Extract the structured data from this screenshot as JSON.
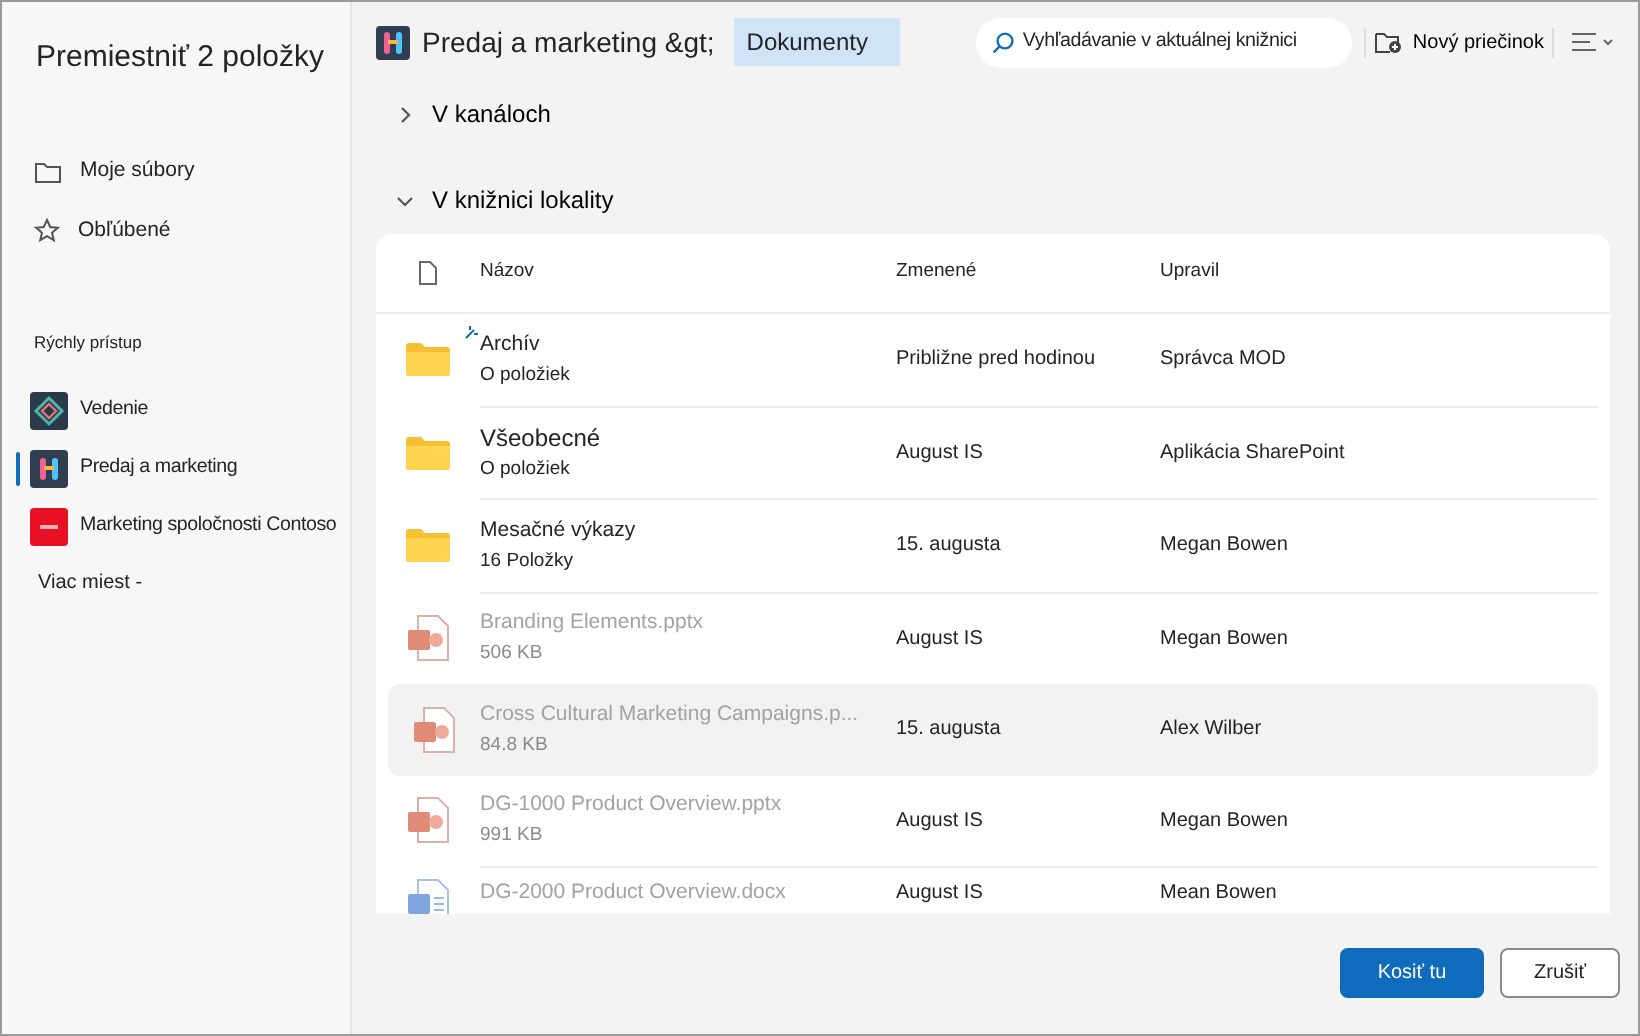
{
  "dialog": {
    "title": "Premiestniť 2 položky"
  },
  "sidebar": {
    "items": [
      {
        "label": "Moje súbory",
        "kind": "folder"
      },
      {
        "label": "Obľúbené",
        "kind": "star"
      }
    ],
    "quick_access": {
      "heading": "Rýchly prístup",
      "sites": [
        {
          "label": "Vedenie",
          "selected": false,
          "color": "#2b3a4a",
          "kind": "diamond"
        },
        {
          "label": "Predaj a marketing",
          "selected": true,
          "color": "#2f3e50",
          "kind": "people"
        },
        {
          "label": "Marketing spoločnosti Contoso",
          "selected": false,
          "color": "#e81123",
          "kind": "initials"
        }
      ]
    },
    "more": "Viac miest -"
  },
  "breadcrumb": {
    "site": "Predaj a marketing &gt;",
    "library": "Dokumenty"
  },
  "search": {
    "placeholder": "Vyhľadávanie v aktuálnej knižnici"
  },
  "new_folder": "Nový priečinok",
  "sections": [
    {
      "label": "V kanáloch",
      "expanded": false
    },
    {
      "label": "V knižnici lokality",
      "expanded": true
    }
  ],
  "table": {
    "columns": [
      "Názov",
      "Zmenené",
      "Upravil"
    ],
    "rows": [
      {
        "kind": "folder",
        "name": "Archív",
        "detail": "O položiek",
        "modified": "Približne pred hodinou",
        "by": "Správca MOD",
        "disabled": false,
        "selected": false,
        "syncing": true
      },
      {
        "kind": "folder",
        "name": "Všeobecné",
        "detail": "O položiek",
        "modified": "August IS",
        "by": "Aplikácia SharePoint",
        "disabled": false,
        "selected": false,
        "syncing": false
      },
      {
        "kind": "folder",
        "name": "Mesačné výkazy",
        "detail": "16 Položky",
        "modified": "15. augusta",
        "by": "Megan Bowen",
        "disabled": false,
        "selected": false,
        "syncing": false
      },
      {
        "kind": "pptx",
        "name": "Branding Elements.pptx",
        "detail": "506 KB",
        "modified": "August IS",
        "by": "Megan Bowen",
        "disabled": true,
        "selected": false,
        "syncing": false
      },
      {
        "kind": "pptx",
        "name": "Cross Cultural Marketing Campaigns.p...",
        "detail": "84.8 KB",
        "modified": "15. augusta",
        "by": "Alex Wilber",
        "disabled": true,
        "selected": true,
        "syncing": false
      },
      {
        "kind": "pptx",
        "name": "DG-1000 Product Overview.pptx",
        "detail": "991 KB",
        "modified": "August IS",
        "by": "Megan Bowen",
        "disabled": true,
        "selected": false,
        "syncing": false
      },
      {
        "kind": "docx",
        "name": "DG-2000 Product Overview.docx",
        "modified": "August IS",
        "by": "Mean Bowen",
        "disabled": true,
        "selected": false,
        "syncing": false
      }
    ]
  },
  "buttons": [
    {
      "label": "Kosiť tu",
      "kind": "primary"
    },
    {
      "label": "Zrušiť",
      "kind": "secondary"
    }
  ]
}
